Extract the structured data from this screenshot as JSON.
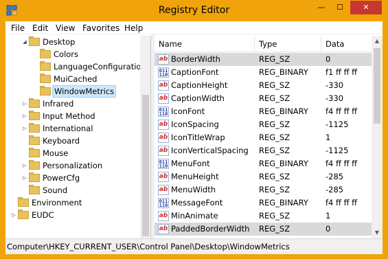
{
  "window": {
    "title": "Registry Editor",
    "controls": {
      "minimize": "—",
      "maximize": "☐",
      "close": "✕"
    }
  },
  "menubar": {
    "items": [
      "File",
      "Edit",
      "View",
      "Favorites",
      "Help"
    ]
  },
  "tree": {
    "items": [
      {
        "label": "Desktop",
        "depth": 1,
        "expander": "expanded"
      },
      {
        "label": "Colors",
        "depth": 2,
        "expander": "none"
      },
      {
        "label": "LanguageConfiguration",
        "depth": 2,
        "expander": "none"
      },
      {
        "label": "MuiCached",
        "depth": 2,
        "expander": "none"
      },
      {
        "label": "WindowMetrics",
        "depth": 2,
        "expander": "none",
        "selected": true
      },
      {
        "label": "Infrared",
        "depth": 1,
        "expander": "collapsed"
      },
      {
        "label": "Input Method",
        "depth": 1,
        "expander": "collapsed"
      },
      {
        "label": "International",
        "depth": 1,
        "expander": "collapsed"
      },
      {
        "label": "Keyboard",
        "depth": 1,
        "expander": "none"
      },
      {
        "label": "Mouse",
        "depth": 1,
        "expander": "none"
      },
      {
        "label": "Personalization",
        "depth": 1,
        "expander": "collapsed"
      },
      {
        "label": "PowerCfg",
        "depth": 1,
        "expander": "collapsed"
      },
      {
        "label": "Sound",
        "depth": 1,
        "expander": "none"
      },
      {
        "label": "Environment",
        "depth": 0,
        "expander": "none"
      },
      {
        "label": "EUDC",
        "depth": 0,
        "expander": "collapsed"
      }
    ]
  },
  "list": {
    "columns": [
      "Name",
      "Type",
      "Data"
    ],
    "rows": [
      {
        "name": "BorderWidth",
        "type": "REG_SZ",
        "data": "0",
        "icon": "string-value-icon",
        "highlight": true
      },
      {
        "name": "CaptionFont",
        "type": "REG_BINARY",
        "data": "f1 ff ff ff",
        "icon": "binary-value-icon"
      },
      {
        "name": "CaptionHeight",
        "type": "REG_SZ",
        "data": "-330",
        "icon": "string-value-icon"
      },
      {
        "name": "CaptionWidth",
        "type": "REG_SZ",
        "data": "-330",
        "icon": "string-value-icon"
      },
      {
        "name": "IconFont",
        "type": "REG_BINARY",
        "data": "f4 ff ff ff",
        "icon": "binary-value-icon"
      },
      {
        "name": "IconSpacing",
        "type": "REG_SZ",
        "data": "-1125",
        "icon": "string-value-icon"
      },
      {
        "name": "IconTitleWrap",
        "type": "REG_SZ",
        "data": "1",
        "icon": "string-value-icon"
      },
      {
        "name": "IconVerticalSpacing",
        "type": "REG_SZ",
        "data": "-1125",
        "icon": "string-value-icon"
      },
      {
        "name": "MenuFont",
        "type": "REG_BINARY",
        "data": "f4 ff ff ff",
        "icon": "binary-value-icon"
      },
      {
        "name": "MenuHeight",
        "type": "REG_SZ",
        "data": "-285",
        "icon": "string-value-icon"
      },
      {
        "name": "MenuWidth",
        "type": "REG_SZ",
        "data": "-285",
        "icon": "string-value-icon"
      },
      {
        "name": "MessageFont",
        "type": "REG_BINARY",
        "data": "f4 ff ff ff",
        "icon": "binary-value-icon"
      },
      {
        "name": "MinAnimate",
        "type": "REG_SZ",
        "data": "1",
        "icon": "string-value-icon"
      },
      {
        "name": "PaddedBorderWidth",
        "type": "REG_SZ",
        "data": "0",
        "icon": "string-value-icon",
        "highlight": true
      }
    ]
  },
  "statusbar": {
    "path": "Computer\\HKEY_CURRENT_USER\\Control Panel\\Desktop\\WindowMetrics"
  },
  "colors": {
    "titlebar": "#f0a30a",
    "close_button": "#c7372f",
    "selection": "#cde8ff",
    "row_highlight": "#d9d9d9"
  }
}
